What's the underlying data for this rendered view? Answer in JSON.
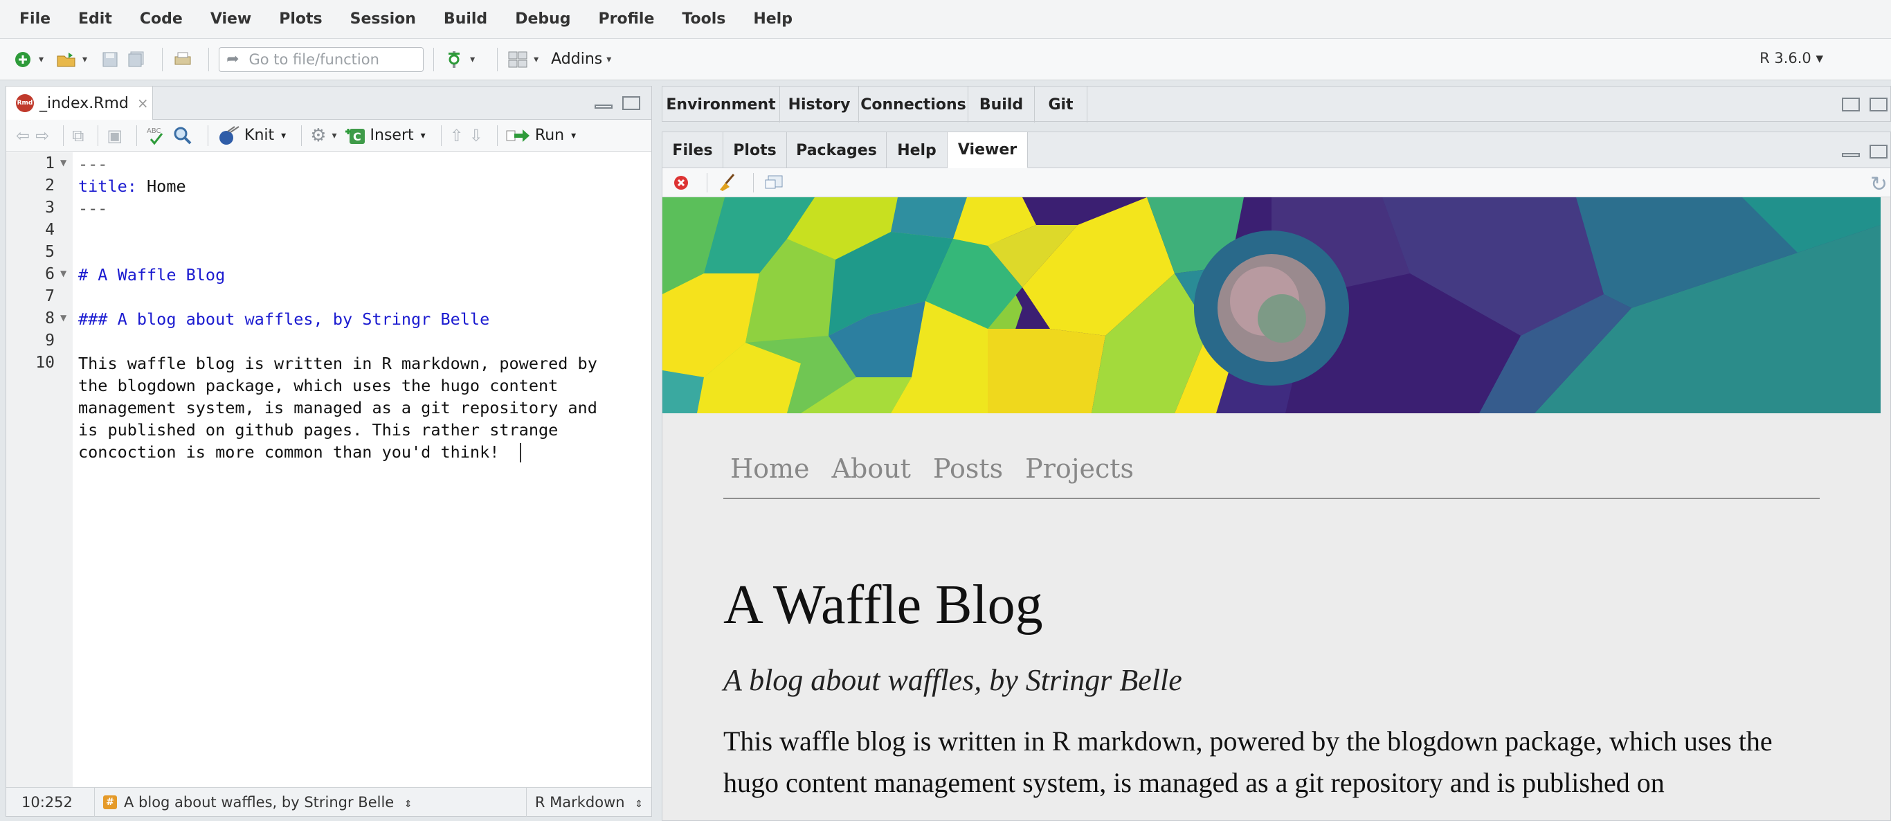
{
  "menu": [
    "File",
    "Edit",
    "Code",
    "View",
    "Plots",
    "Session",
    "Build",
    "Debug",
    "Profile",
    "Tools",
    "Help"
  ],
  "toolbar": {
    "goto_placeholder": "Go to file/function",
    "addins_label": "Addins",
    "r_version": "R 3.6.0"
  },
  "editor": {
    "tab_title": "_index.Rmd",
    "knit_label": "Knit",
    "insert_label": "Insert",
    "run_label": "Run",
    "line_numbers": [
      "1",
      "2",
      "3",
      "4",
      "5",
      "6",
      "7",
      "8",
      "9",
      "10"
    ],
    "lines": {
      "l1": "---",
      "l2_key": "title:",
      "l2_val": " Home",
      "l3": "---",
      "l6": "# A Waffle Blog",
      "l8": "### A blog about waffles, by Stringr Belle",
      "l10_a": "This waffle blog is written in R markdown, powered by",
      "l10_b": "the blogdown package, which uses the hugo content",
      "l10_c": "management system, is managed as a git repository and",
      "l10_d": "is published on github pages. This rather strange",
      "l10_e": "concoction is more common than you'd think!"
    },
    "status": {
      "cursor": "10:252",
      "section": "A blog about waffles, by Stringr Belle",
      "filetype": "R Markdown"
    }
  },
  "top_right_tabs": [
    "Environment",
    "History",
    "Connections",
    "Build",
    "Git"
  ],
  "bottom_right_tabs": [
    "Files",
    "Plots",
    "Packages",
    "Help",
    "Viewer"
  ],
  "active_bottom_tab": "Viewer",
  "viewer": {
    "nav": [
      "Home",
      "About",
      "Posts",
      "Projects"
    ],
    "title": "A Waffle Blog",
    "subtitle": "A blog about waffles, by Stringr Belle",
    "body": "This waffle blog is written in R markdown, powered by the blogdown package, which uses the hugo content management system, is managed as a git repository and is published on"
  },
  "colors": {
    "yaml_key": "#1b1bd0",
    "heading": "#1b1bd0",
    "viewer_bg": "#ececec"
  }
}
